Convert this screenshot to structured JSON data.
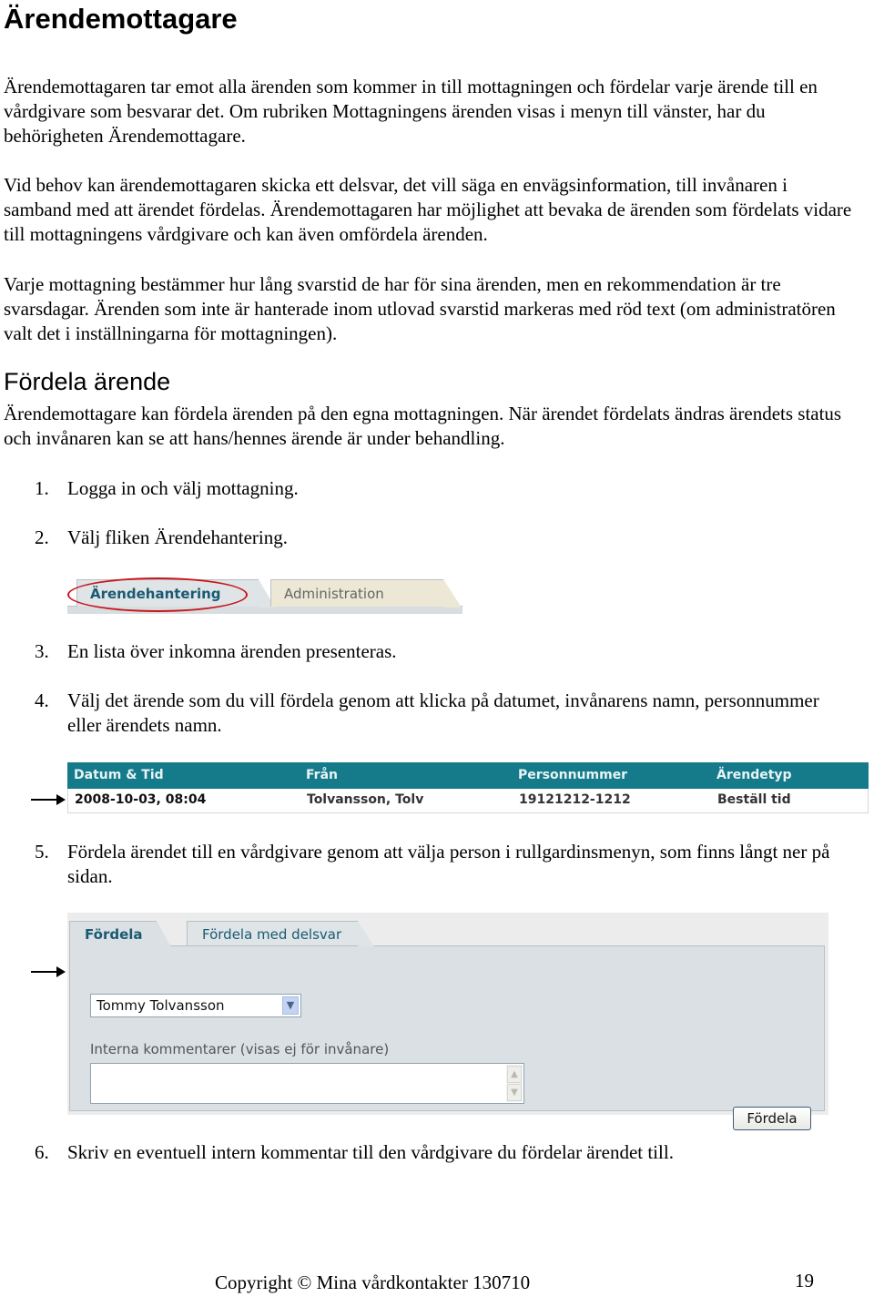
{
  "document": {
    "title": "Ärendemottagare",
    "paragraphs": [
      "Ärendemottagaren tar emot alla ärenden som kommer in till mottagningen och fördelar varje ärende till en vårdgivare som besvarar det. Om rubriken Mottagningens ärenden visas i menyn till vänster, har du behörigheten Ärendemottagare.",
      "Vid behov kan ärendemottagaren skicka ett delsvar, det vill säga en envägsinformation, till invånaren i samband med att ärendet fördelas. Ärendemottagaren har möjlighet att bevaka de ärenden som fördelats vidare till mottagningens vårdgivare och kan även omfördela ärenden.",
      "Varje mottagning bestämmer hur lång svarstid de har för sina ärenden, men en rekommendation är tre svarsdagar. Ärenden som inte är hanterade inom utlovad svarstid markeras med röd text (om administratören valt det i inställningarna för mottagningen)."
    ],
    "section": {
      "heading": "Fördela ärende",
      "intro": "Ärendemottagare kan fördela ärenden på den egna mottagningen. När ärendet fördelats ändras ärendets status och invånaren kan se att hans/hennes ärende är under behandling."
    },
    "steps": [
      {
        "num": "1.",
        "text": "Logga in och välj mottagning."
      },
      {
        "num": "2.",
        "text": "Välj fliken Ärendehantering."
      },
      {
        "num": "3.",
        "text": "En lista över inkomna ärenden presenteras."
      },
      {
        "num": "4.",
        "text": "Välj det ärende som du vill fördela genom att klicka på datumet, invånarens namn, personnummer eller ärendets namn."
      },
      {
        "num": "5.",
        "text": "Fördela ärendet till en vårdgivare genom att välja person i rullgardinsmenyn, som finns långt ner på sidan."
      },
      {
        "num": "6.",
        "text": "Skriv en eventuell intern kommentar till den vårdgivare du fördelar ärendet till."
      }
    ],
    "footer": {
      "copyright": "Copyright © Mina vårdkontakter 130710",
      "page_number": "19"
    }
  },
  "screenshot_tabs": {
    "tabs": [
      {
        "label": "Ärendehantering",
        "highlighted": true
      },
      {
        "label": "Administration",
        "highlighted": false
      }
    ],
    "highlight_color": "#c8161c"
  },
  "screenshot_table": {
    "columns": [
      "Datum & Tid",
      "Från",
      "Personnummer",
      "Ärendetyp"
    ],
    "rows": [
      [
        "2008-10-03, 08:04",
        "Tolvansson, Tolv",
        "19121212-1212",
        "Beställ tid"
      ]
    ],
    "header_color": "#157a8a"
  },
  "screenshot_form": {
    "tabs": [
      {
        "label": "Fördela",
        "active": true
      },
      {
        "label": "Fördela med delsvar",
        "active": false
      }
    ],
    "select_value": "Tommy Tolvansson",
    "comment_label": "Interna kommentarer (visas ej för invånare)",
    "comment_value": "",
    "submit_label": "Fördela",
    "icons": {
      "dropdown": "chevron-down-icon",
      "scroll_up": "chevron-up-icon",
      "scroll_down": "chevron-down-icon"
    },
    "glyphs": {
      "down": "▼",
      "up": "▲"
    }
  }
}
